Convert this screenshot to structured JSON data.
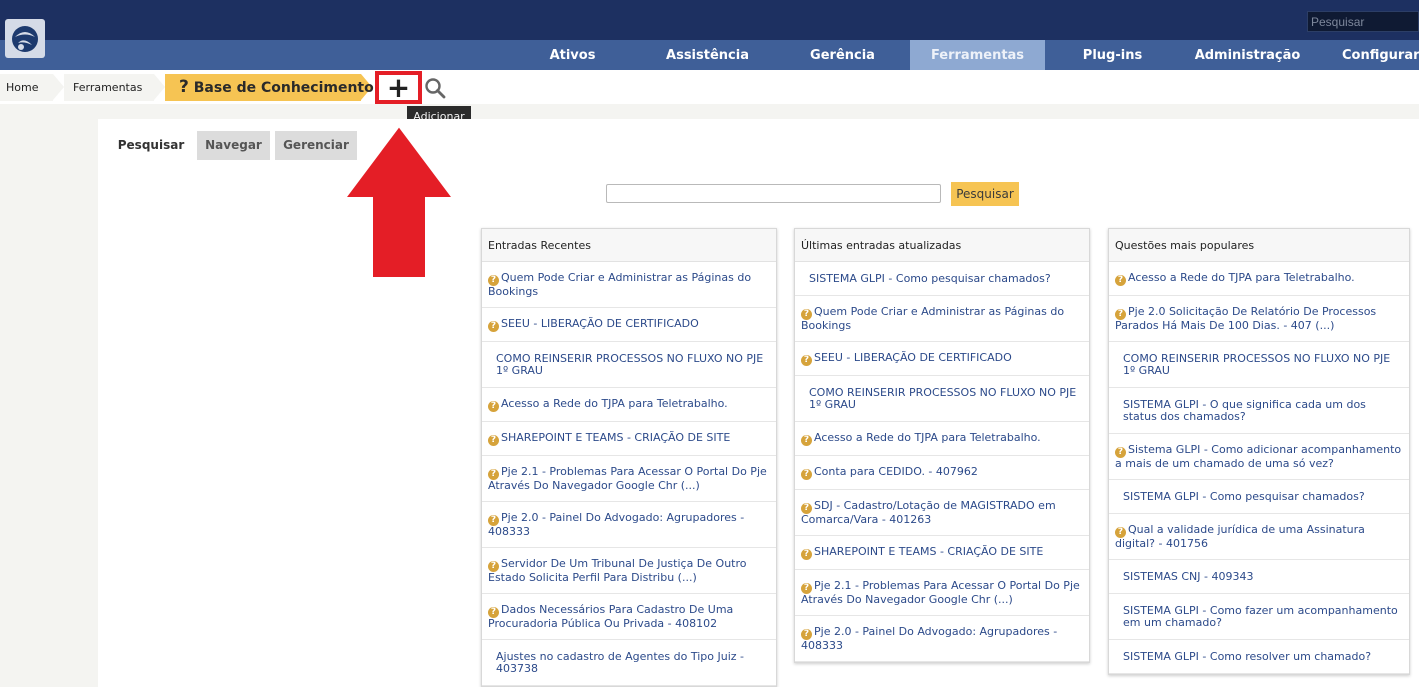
{
  "topbar": {
    "search_placeholder": "Pesquisar"
  },
  "menu": [
    "Ativos",
    "Assistência",
    "Gerência",
    "Ferramentas",
    "Plug-ins",
    "Administração",
    "Configurar"
  ],
  "breadcrumb": {
    "home": "Home",
    "tools": "Ferramentas",
    "current_icon": "?",
    "current": "Base de Conhecimento"
  },
  "actions": {
    "add_symbol": "+",
    "add_tooltip": "Adicionar"
  },
  "tabs": [
    "Pesquisar",
    "Navegar",
    "Gerenciar"
  ],
  "kb_search": {
    "button": "Pesquisar"
  },
  "columns": [
    {
      "title": "Entradas Recentes",
      "items": [
        {
          "faq": true,
          "text": "Quem Pode Criar e Administrar as Páginas do Bookings"
        },
        {
          "faq": true,
          "text": "SEEU - LIBERAÇÃO DE CERTIFICADO"
        },
        {
          "faq": false,
          "text": "COMO REINSERIR PROCESSOS NO FLUXO NO PJE 1º GRAU"
        },
        {
          "faq": true,
          "text": "Acesso a Rede do TJPA para Teletrabalho."
        },
        {
          "faq": true,
          "text": "SHAREPOINT E TEAMS - CRIAÇÃO DE SITE"
        },
        {
          "faq": true,
          "text": "Pje 2.1 - Problemas Para Acessar O Portal Do Pje Através Do Navegador Google Chr (...)"
        },
        {
          "faq": true,
          "text": "Pje 2.0 - Painel Do Advogado: Agrupadores - 408333"
        },
        {
          "faq": true,
          "text": "Servidor De Um Tribunal De Justiça De Outro Estado Solicita Perfil Para Distribu (...)"
        },
        {
          "faq": true,
          "text": "Dados Necessários Para Cadastro De Uma Procuradoria Pública Ou Privada - 408102"
        },
        {
          "faq": false,
          "text": "Ajustes no cadastro de Agentes do Tipo Juiz - 403738"
        }
      ]
    },
    {
      "title": "Últimas entradas atualizadas",
      "items": [
        {
          "faq": false,
          "text": "SISTEMA GLPI - Como pesquisar chamados?"
        },
        {
          "faq": true,
          "text": "Quem Pode Criar e Administrar as Páginas do Bookings"
        },
        {
          "faq": true,
          "text": "SEEU - LIBERAÇÃO DE CERTIFICADO"
        },
        {
          "faq": false,
          "text": "COMO REINSERIR PROCESSOS NO FLUXO NO PJE 1º GRAU"
        },
        {
          "faq": true,
          "text": "Acesso a Rede do TJPA para Teletrabalho."
        },
        {
          "faq": true,
          "text": "Conta para CEDIDO. - 407962"
        },
        {
          "faq": true,
          "text": "SDJ - Cadastro/Lotação de MAGISTRADO em Comarca/Vara - 401263"
        },
        {
          "faq": true,
          "text": "SHAREPOINT E TEAMS - CRIAÇÃO DE SITE"
        },
        {
          "faq": true,
          "text": "Pje 2.1 - Problemas Para Acessar O Portal Do Pje Através Do Navegador Google Chr (...)"
        },
        {
          "faq": true,
          "text": "Pje 2.0 - Painel Do Advogado: Agrupadores - 408333"
        }
      ]
    },
    {
      "title": "Questões mais populares",
      "items": [
        {
          "faq": true,
          "text": "Acesso a Rede do TJPA para Teletrabalho."
        },
        {
          "faq": true,
          "text": "Pje 2.0 Solicitação De Relatório De Processos Parados Há Mais De 100 Dias. - 407 (...)"
        },
        {
          "faq": false,
          "text": "COMO REINSERIR PROCESSOS NO FLUXO NO PJE 1º GRAU"
        },
        {
          "faq": false,
          "text": "SISTEMA GLPI - O que significa cada um dos status dos chamados?"
        },
        {
          "faq": true,
          "text": "Sistema GLPI - Como adicionar acompanhamento a mais de um chamado de uma só vez?"
        },
        {
          "faq": false,
          "text": "SISTEMA GLPI - Como pesquisar chamados?"
        },
        {
          "faq": true,
          "text": "Qual a validade jurídica de uma Assinatura digital? - 401756"
        },
        {
          "faq": false,
          "text": "SISTEMAS CNJ - 409343"
        },
        {
          "faq": false,
          "text": "SISTEMA GLPI - Como fazer um acompanhamento em um chamado?"
        },
        {
          "faq": false,
          "text": "SISTEMA GLPI - Como resolver um chamado?"
        }
      ]
    }
  ],
  "colors": {
    "topbar": "#1d3061",
    "menubar": "#3f5f98",
    "menu_active": "#8ea9d2",
    "accent": "#f6c453",
    "highlight": "#e41e26",
    "link": "#2c4a8a"
  }
}
